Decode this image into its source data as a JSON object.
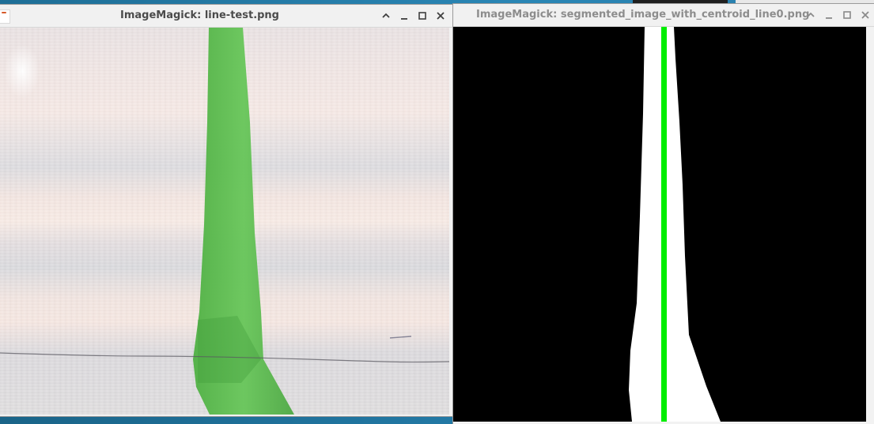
{
  "windows": [
    {
      "title": "ImageMagick: line-test.png",
      "state": "active",
      "image": {
        "kind": "photo",
        "description_hidden": true
      }
    },
    {
      "title": "ImageMagick: segmented_image_with_centroid_line0.png",
      "state": "inactive",
      "image": {
        "kind": "binary-mask"
      }
    }
  ],
  "controls": {
    "shade_icon": "chevron-up-icon",
    "minimize_icon": "minimize-icon",
    "maximize_icon": "maximize-icon",
    "close_icon": "close-icon"
  },
  "colors": {
    "tape_green": "#5cbf4f",
    "centroid_line": "#00ee00",
    "mask_fg": "#ffffff",
    "mask_bg": "#000000"
  }
}
